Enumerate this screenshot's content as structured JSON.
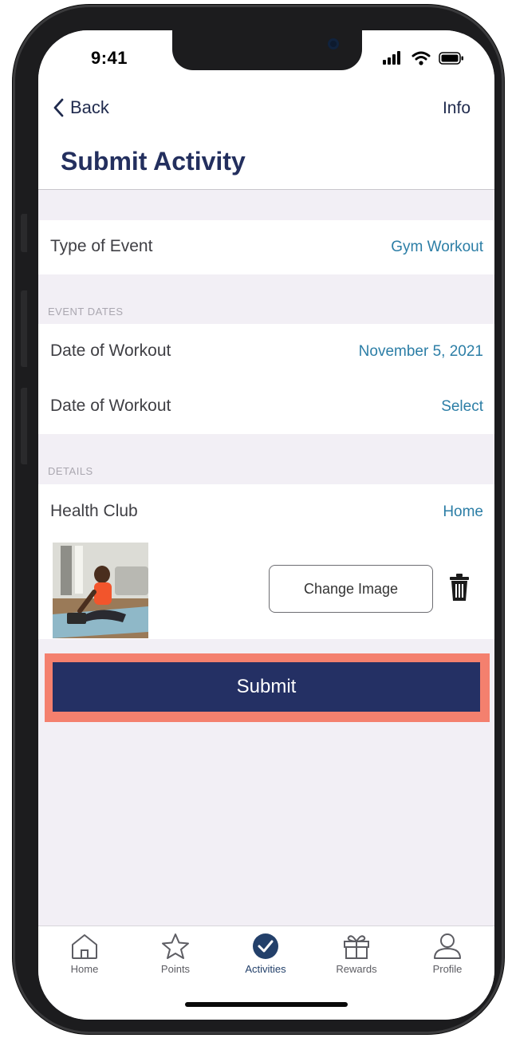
{
  "status": {
    "time": "9:41"
  },
  "nav": {
    "back": "Back",
    "info": "Info",
    "title": "Submit Activity"
  },
  "rows": {
    "type_of_event": {
      "label": "Type of Event",
      "value": "Gym Workout"
    },
    "event_dates_header": "EVENT DATES",
    "date_1": {
      "label": "Date of Workout",
      "value": "November 5, 2021"
    },
    "date_2": {
      "label": "Date of Workout",
      "value": "Select"
    },
    "details_header": "DETAILS",
    "health_club": {
      "label": "Health Club",
      "value": "Home"
    }
  },
  "image": {
    "change_label": "Change Image"
  },
  "submit_label": "Submit",
  "tabs": [
    {
      "label": "Home",
      "icon": "home-icon"
    },
    {
      "label": "Points",
      "icon": "star-icon"
    },
    {
      "label": "Activities",
      "icon": "check-circle-icon"
    },
    {
      "label": "Rewards",
      "icon": "gift-icon"
    },
    {
      "label": "Profile",
      "icon": "person-icon"
    }
  ],
  "colors": {
    "accent": "#2c7ea6",
    "primary": "#243064",
    "highlight": "#f4806e",
    "background": "#f2eff5"
  }
}
